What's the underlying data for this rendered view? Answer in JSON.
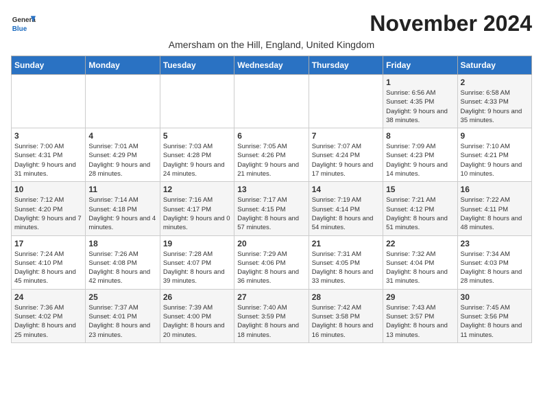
{
  "logo": {
    "general": "General",
    "blue": "Blue"
  },
  "title": "November 2024",
  "subtitle": "Amersham on the Hill, England, United Kingdom",
  "days_header": [
    "Sunday",
    "Monday",
    "Tuesday",
    "Wednesday",
    "Thursday",
    "Friday",
    "Saturday"
  ],
  "weeks": [
    [
      {
        "day": "",
        "info": ""
      },
      {
        "day": "",
        "info": ""
      },
      {
        "day": "",
        "info": ""
      },
      {
        "day": "",
        "info": ""
      },
      {
        "day": "",
        "info": ""
      },
      {
        "day": "1",
        "info": "Sunrise: 6:56 AM\nSunset: 4:35 PM\nDaylight: 9 hours and 38 minutes."
      },
      {
        "day": "2",
        "info": "Sunrise: 6:58 AM\nSunset: 4:33 PM\nDaylight: 9 hours and 35 minutes."
      }
    ],
    [
      {
        "day": "3",
        "info": "Sunrise: 7:00 AM\nSunset: 4:31 PM\nDaylight: 9 hours and 31 minutes."
      },
      {
        "day": "4",
        "info": "Sunrise: 7:01 AM\nSunset: 4:29 PM\nDaylight: 9 hours and 28 minutes."
      },
      {
        "day": "5",
        "info": "Sunrise: 7:03 AM\nSunset: 4:28 PM\nDaylight: 9 hours and 24 minutes."
      },
      {
        "day": "6",
        "info": "Sunrise: 7:05 AM\nSunset: 4:26 PM\nDaylight: 9 hours and 21 minutes."
      },
      {
        "day": "7",
        "info": "Sunrise: 7:07 AM\nSunset: 4:24 PM\nDaylight: 9 hours and 17 minutes."
      },
      {
        "day": "8",
        "info": "Sunrise: 7:09 AM\nSunset: 4:23 PM\nDaylight: 9 hours and 14 minutes."
      },
      {
        "day": "9",
        "info": "Sunrise: 7:10 AM\nSunset: 4:21 PM\nDaylight: 9 hours and 10 minutes."
      }
    ],
    [
      {
        "day": "10",
        "info": "Sunrise: 7:12 AM\nSunset: 4:20 PM\nDaylight: 9 hours and 7 minutes."
      },
      {
        "day": "11",
        "info": "Sunrise: 7:14 AM\nSunset: 4:18 PM\nDaylight: 9 hours and 4 minutes."
      },
      {
        "day": "12",
        "info": "Sunrise: 7:16 AM\nSunset: 4:17 PM\nDaylight: 9 hours and 0 minutes."
      },
      {
        "day": "13",
        "info": "Sunrise: 7:17 AM\nSunset: 4:15 PM\nDaylight: 8 hours and 57 minutes."
      },
      {
        "day": "14",
        "info": "Sunrise: 7:19 AM\nSunset: 4:14 PM\nDaylight: 8 hours and 54 minutes."
      },
      {
        "day": "15",
        "info": "Sunrise: 7:21 AM\nSunset: 4:12 PM\nDaylight: 8 hours and 51 minutes."
      },
      {
        "day": "16",
        "info": "Sunrise: 7:22 AM\nSunset: 4:11 PM\nDaylight: 8 hours and 48 minutes."
      }
    ],
    [
      {
        "day": "17",
        "info": "Sunrise: 7:24 AM\nSunset: 4:10 PM\nDaylight: 8 hours and 45 minutes."
      },
      {
        "day": "18",
        "info": "Sunrise: 7:26 AM\nSunset: 4:08 PM\nDaylight: 8 hours and 42 minutes."
      },
      {
        "day": "19",
        "info": "Sunrise: 7:28 AM\nSunset: 4:07 PM\nDaylight: 8 hours and 39 minutes."
      },
      {
        "day": "20",
        "info": "Sunrise: 7:29 AM\nSunset: 4:06 PM\nDaylight: 8 hours and 36 minutes."
      },
      {
        "day": "21",
        "info": "Sunrise: 7:31 AM\nSunset: 4:05 PM\nDaylight: 8 hours and 33 minutes."
      },
      {
        "day": "22",
        "info": "Sunrise: 7:32 AM\nSunset: 4:04 PM\nDaylight: 8 hours and 31 minutes."
      },
      {
        "day": "23",
        "info": "Sunrise: 7:34 AM\nSunset: 4:03 PM\nDaylight: 8 hours and 28 minutes."
      }
    ],
    [
      {
        "day": "24",
        "info": "Sunrise: 7:36 AM\nSunset: 4:02 PM\nDaylight: 8 hours and 25 minutes."
      },
      {
        "day": "25",
        "info": "Sunrise: 7:37 AM\nSunset: 4:01 PM\nDaylight: 8 hours and 23 minutes."
      },
      {
        "day": "26",
        "info": "Sunrise: 7:39 AM\nSunset: 4:00 PM\nDaylight: 8 hours and 20 minutes."
      },
      {
        "day": "27",
        "info": "Sunrise: 7:40 AM\nSunset: 3:59 PM\nDaylight: 8 hours and 18 minutes."
      },
      {
        "day": "28",
        "info": "Sunrise: 7:42 AM\nSunset: 3:58 PM\nDaylight: 8 hours and 16 minutes."
      },
      {
        "day": "29",
        "info": "Sunrise: 7:43 AM\nSunset: 3:57 PM\nDaylight: 8 hours and 13 minutes."
      },
      {
        "day": "30",
        "info": "Sunrise: 7:45 AM\nSunset: 3:56 PM\nDaylight: 8 hours and 11 minutes."
      }
    ]
  ]
}
